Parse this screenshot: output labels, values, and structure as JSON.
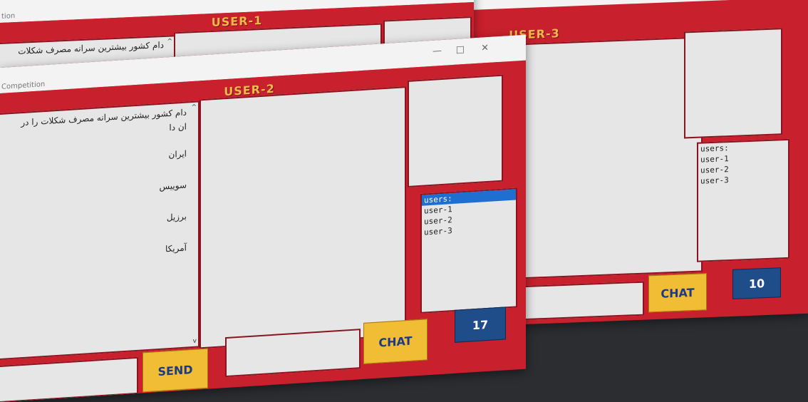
{
  "user1": {
    "title": "tion",
    "banner": "USER-1",
    "message_line": "دام کشور بیشترین سرانه مصرف شکلات"
  },
  "user2": {
    "title": "Competition",
    "banner": "USER-2",
    "question_line1": "دام کشور بیشترین سرانه مصرف شکلات را در",
    "question_line2": "ان دا",
    "options": [
      "ایران",
      "سوییس",
      "برزیل",
      "آمریکا"
    ],
    "users_list": [
      "users:",
      "user-1",
      "user-2",
      "user-3"
    ],
    "send_label": "SEND",
    "chat_label": "CHAT",
    "counter": "17",
    "min_glyph": "—",
    "max_glyph": "□",
    "close_glyph": "✕"
  },
  "user3": {
    "banner": "USER-3",
    "users_list": [
      "users:",
      "user-1",
      "user-2",
      "user-3"
    ],
    "chat_label": "CHAT",
    "counter": "10",
    "min_glyph": "—",
    "close_glyph": "✕"
  },
  "colors": {
    "frame_red": "#c8202d",
    "banner_text": "#f1b94a",
    "button_yellow": "#f0bd35",
    "button_blue": "#1f4d8a",
    "selection_blue": "#1e6fd0"
  }
}
